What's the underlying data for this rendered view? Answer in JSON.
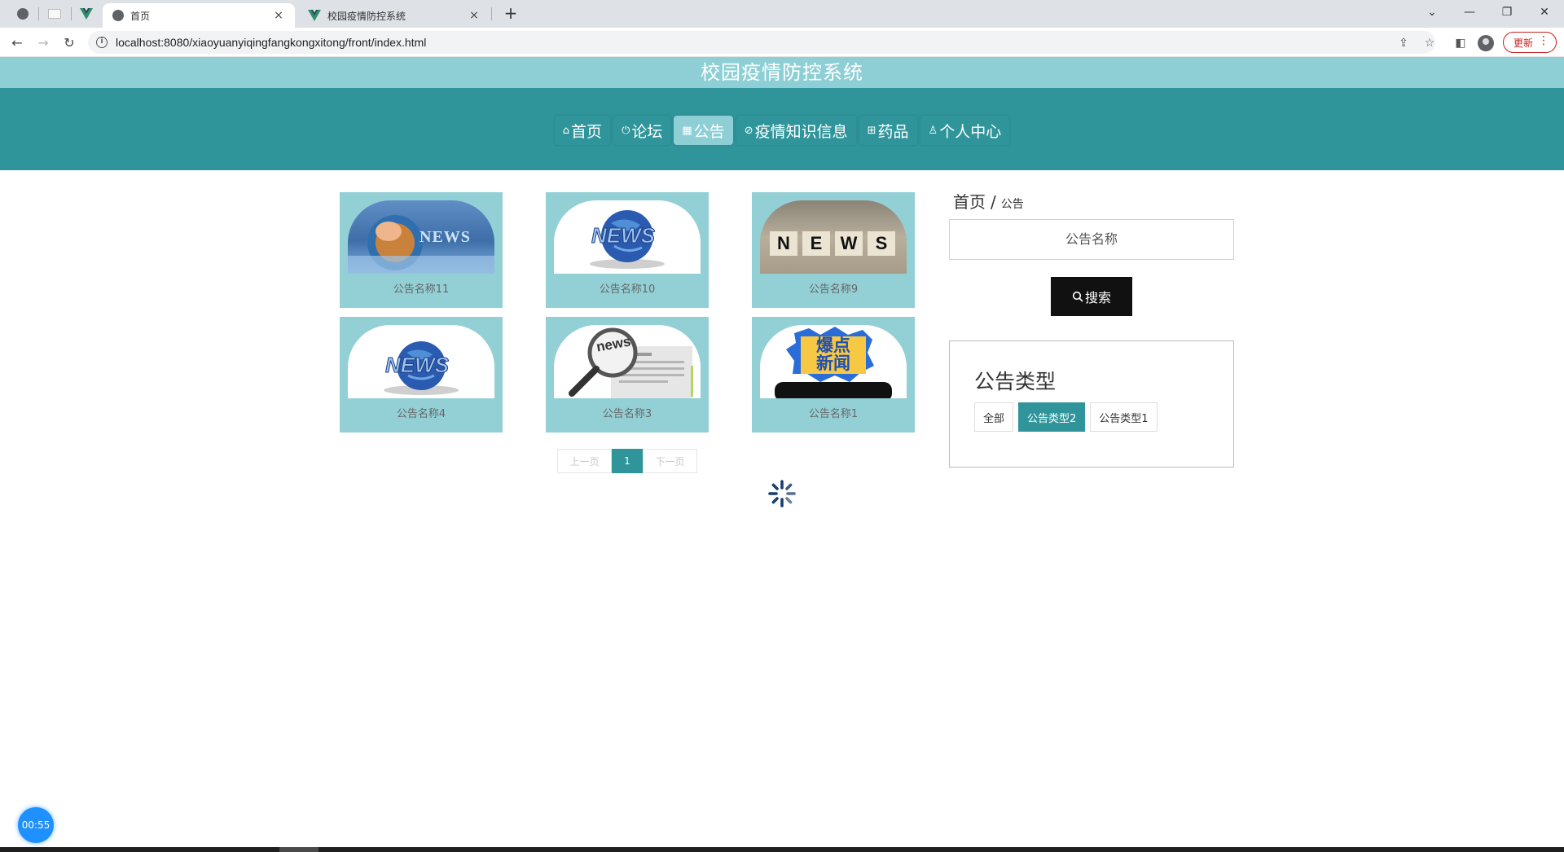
{
  "browser": {
    "tabs": [
      {
        "title": "首页",
        "close": "×"
      },
      {
        "title": "校园疫情防控系统",
        "close": "×"
      }
    ],
    "new_tab": "+",
    "url": "localhost:8080/xiaoyuanyiqingfangkongxitong/front/index.html",
    "update_label": "更新",
    "update_menu": "⋮"
  },
  "site": {
    "title": "校园疫情防控系统",
    "nav": [
      {
        "icon": "home-icon",
        "label": "首页",
        "glyph": "⌂"
      },
      {
        "icon": "forum-icon",
        "label": "论坛",
        "glyph": "⏻"
      },
      {
        "icon": "notice-icon",
        "label": "公告",
        "glyph": "▦"
      },
      {
        "icon": "knowledge-icon",
        "label": "疫情知识信息",
        "glyph": "⊘"
      },
      {
        "icon": "medicine-icon",
        "label": "药品",
        "glyph": "⊞"
      },
      {
        "icon": "user-icon",
        "label": "个人中心",
        "glyph": "♙"
      }
    ]
  },
  "cards": [
    {
      "caption": "公告名称11",
      "image": "news-globe-hand"
    },
    {
      "caption": "公告名称10",
      "image": "news-globe"
    },
    {
      "caption": "公告名称9",
      "image": "news-blocks"
    },
    {
      "caption": "公告名称4",
      "image": "news-globe"
    },
    {
      "caption": "公告名称3",
      "image": "news-magnifier"
    },
    {
      "caption": "公告名称1",
      "image": "breaking-news"
    }
  ],
  "thumb_text": {
    "news": "NEWS",
    "blocks": [
      "N",
      "E",
      "W",
      "S"
    ],
    "magnifier": "news",
    "breaking": "爆点\n新闻"
  },
  "pager": {
    "prev": "上一页",
    "current": "1",
    "next": "下一页"
  },
  "sidebar": {
    "breadcrumb_home": "首页",
    "breadcrumb_sep": "/",
    "breadcrumb_current": "公告",
    "search_placeholder": "公告名称",
    "search_button": "搜索",
    "type_title": "公告类型",
    "types": [
      {
        "label": "全部",
        "active": false
      },
      {
        "label": "公告类型2",
        "active": true
      },
      {
        "label": "公告类型1",
        "active": false
      }
    ]
  },
  "timer": "00:55",
  "colors": {
    "teal": "#2f959b",
    "light_teal": "#8ecfd6",
    "card": "#93d0d6"
  }
}
